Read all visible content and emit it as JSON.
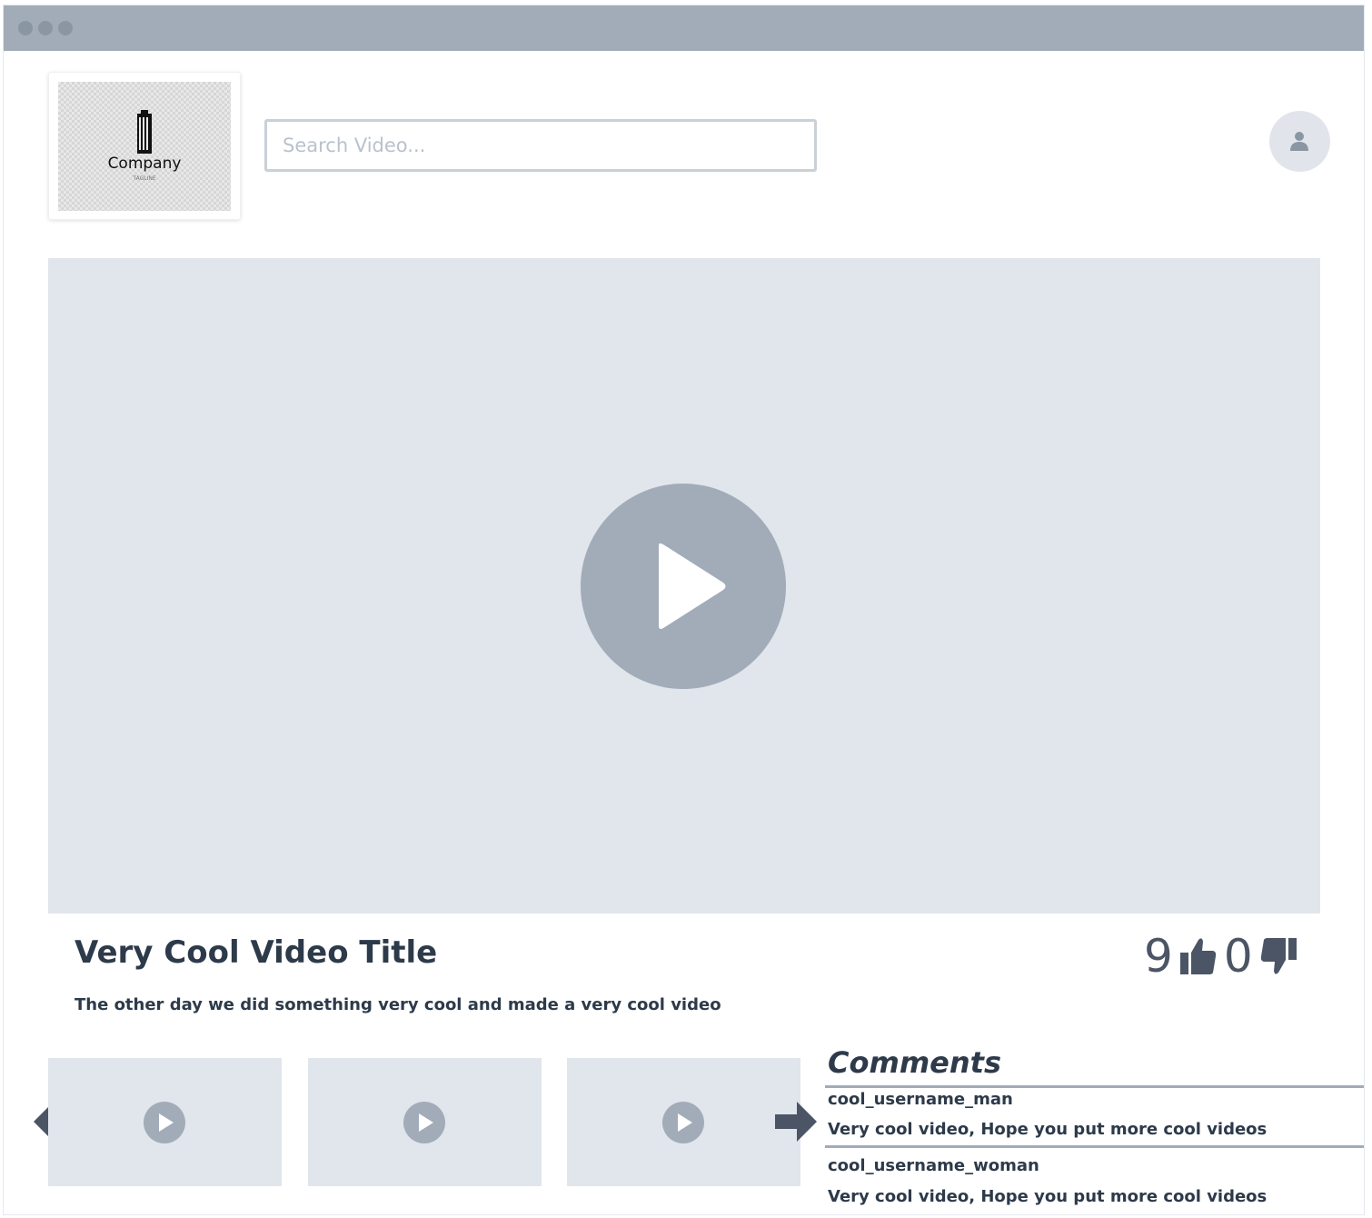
{
  "window": {
    "titlebar_color": "#a1acb8"
  },
  "header": {
    "logo": {
      "name": "Company",
      "tagline": "TAGLINE"
    },
    "search": {
      "placeholder": "Search Video...",
      "value": ""
    },
    "avatar_icon": "user-icon"
  },
  "player": {
    "play_icon": "play-icon",
    "background": "#e1e5ec",
    "button_color": "#a1acb8"
  },
  "video": {
    "title": "Very Cool Video Title",
    "description": "The other day we did something very cool and made a very cool video",
    "likes": "9",
    "dislikes": "0",
    "like_icon": "thumbs-up-icon",
    "dislike_icon": "thumbs-down-icon"
  },
  "related": {
    "prev_icon": "arrow-left-icon",
    "next_icon": "arrow-right-icon",
    "items": [
      {
        "icon": "play-icon"
      },
      {
        "icon": "play-icon"
      },
      {
        "icon": "play-icon"
      }
    ]
  },
  "comments": {
    "heading": "Comments",
    "items": [
      {
        "user": "cool_username_man",
        "text": "Very cool video, Hope you put more cool videos"
      },
      {
        "user": "cool_username_woman",
        "text": "Very cool video, Hope you put more cool videos"
      }
    ]
  }
}
